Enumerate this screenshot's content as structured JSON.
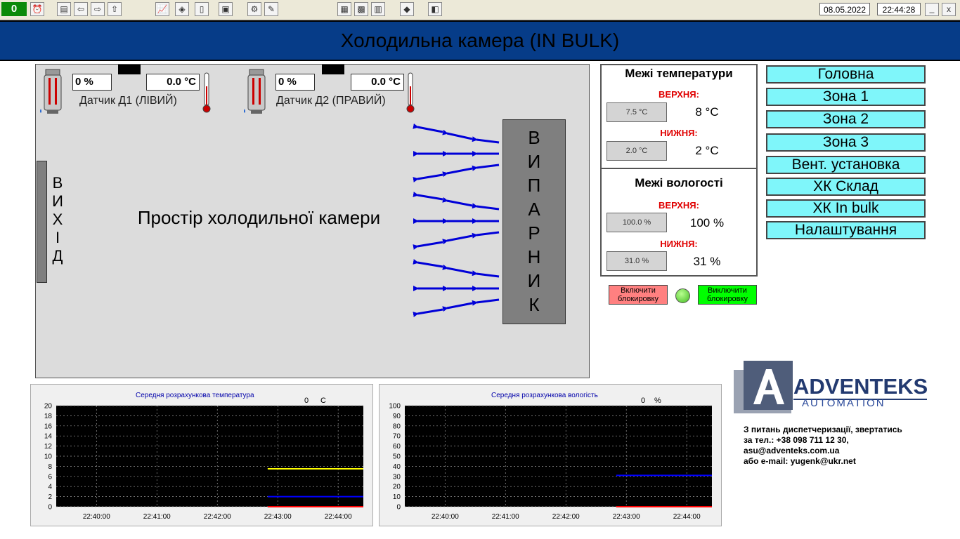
{
  "toolbar": {
    "counter": "0",
    "date": "08.05.2022",
    "time": "22:44:28",
    "minimize": "_",
    "close": "x"
  },
  "header": {
    "title": "Холодильна камера (IN BULK)"
  },
  "room": {
    "sensor1": {
      "humidity": "0 %",
      "temperature": "0.0 °C",
      "label": "Датчик Д1 (ЛІВИЙ)"
    },
    "sensor2": {
      "humidity": "0 %",
      "temperature": "0.0 °C",
      "label": "Датчик Д2 (ПРАВИЙ)"
    },
    "exit_letters": [
      "В",
      "И",
      "Х",
      "І",
      "Д"
    ],
    "space_label": "Простір холодильної камери",
    "evaporator_letters": [
      "В",
      "И",
      "П",
      "А",
      "Р",
      "Н",
      "И",
      "К"
    ]
  },
  "temp_limits": {
    "title": "Межі температури",
    "upper_label": "ВЕРХНЯ:",
    "upper_button": "7.5 °C",
    "upper_value": "8 °C",
    "lower_label": "НИЖНЯ:",
    "lower_button": "2.0 °C",
    "lower_value": "2 °C"
  },
  "hum_limits": {
    "title": "Межі вологості",
    "upper_label": "ВЕРХНЯ:",
    "upper_button": "100.0 %",
    "upper_value": "100 %",
    "lower_label": "НИЖНЯ:",
    "lower_button": "31.0 %",
    "lower_value": "31 %"
  },
  "blocking": {
    "enable_line1": "Включити",
    "enable_line2": "блокировку",
    "disable_line1": "Виключити",
    "disable_line2": "блокировку",
    "enable_color": "#ff8080",
    "disable_color": "#00ff00",
    "indicator_color": "#66dd44"
  },
  "nav": {
    "items": [
      "Головна",
      "Зона 1",
      "Зона 2",
      "Зона 3",
      "Вент. установка",
      "ХК Склад",
      "ХК In bulk",
      "Налаштування"
    ]
  },
  "charts": {
    "temp": {
      "title": "Середня розрахункова температура",
      "current_value": "0",
      "current_unit": "C"
    },
    "hum": {
      "title": "Середня розрахункова вологість",
      "current_value": "0",
      "current_unit": "%"
    }
  },
  "chart_data": [
    {
      "type": "line",
      "title": "Середня розрахункова температура",
      "x_ticks": [
        "22:40:00",
        "22:41:00",
        "22:42:00",
        "22:43:00",
        "22:44:00"
      ],
      "ylim": [
        0,
        20
      ],
      "y_ticks": [
        0,
        2,
        4,
        6,
        8,
        10,
        12,
        14,
        16,
        18,
        20
      ],
      "grid": true,
      "series": [
        {
          "color": "#ffff00",
          "x": [
            "22:42:50",
            "22:44:25"
          ],
          "values": [
            7.5,
            7.5
          ]
        },
        {
          "color": "#0000ff",
          "x": [
            "22:42:50",
            "22:44:25"
          ],
          "values": [
            2.0,
            2.0
          ]
        },
        {
          "color": "#ff0000",
          "x": [
            "22:42:50",
            "22:44:25"
          ],
          "values": [
            0,
            0
          ]
        }
      ]
    },
    {
      "type": "line",
      "title": "Середня розрахункова вологість",
      "x_ticks": [
        "22:40:00",
        "22:41:00",
        "22:42:00",
        "22:43:00",
        "22:44:00"
      ],
      "ylim": [
        0,
        100
      ],
      "y_ticks": [
        0,
        10,
        20,
        30,
        40,
        50,
        60,
        70,
        80,
        90,
        100
      ],
      "grid": true,
      "series": [
        {
          "color": "#0000ff",
          "x": [
            "22:42:50",
            "22:44:25"
          ],
          "values": [
            31,
            31
          ]
        },
        {
          "color": "#ff0000",
          "x": [
            "22:42:50",
            "22:44:25"
          ],
          "values": [
            0,
            0
          ]
        }
      ]
    }
  ],
  "logo": {
    "name": "ADVENTEKS",
    "sub": "AUTOMATION",
    "letter": "A"
  },
  "contact": {
    "line1": "З питань диспетчеризації, звертатись",
    "line2": "за тел.: +38 098 711 12 30,",
    "line3": "asu@adventeks.com.ua",
    "line4": "або e-mail: yugenk@ukr.net"
  }
}
